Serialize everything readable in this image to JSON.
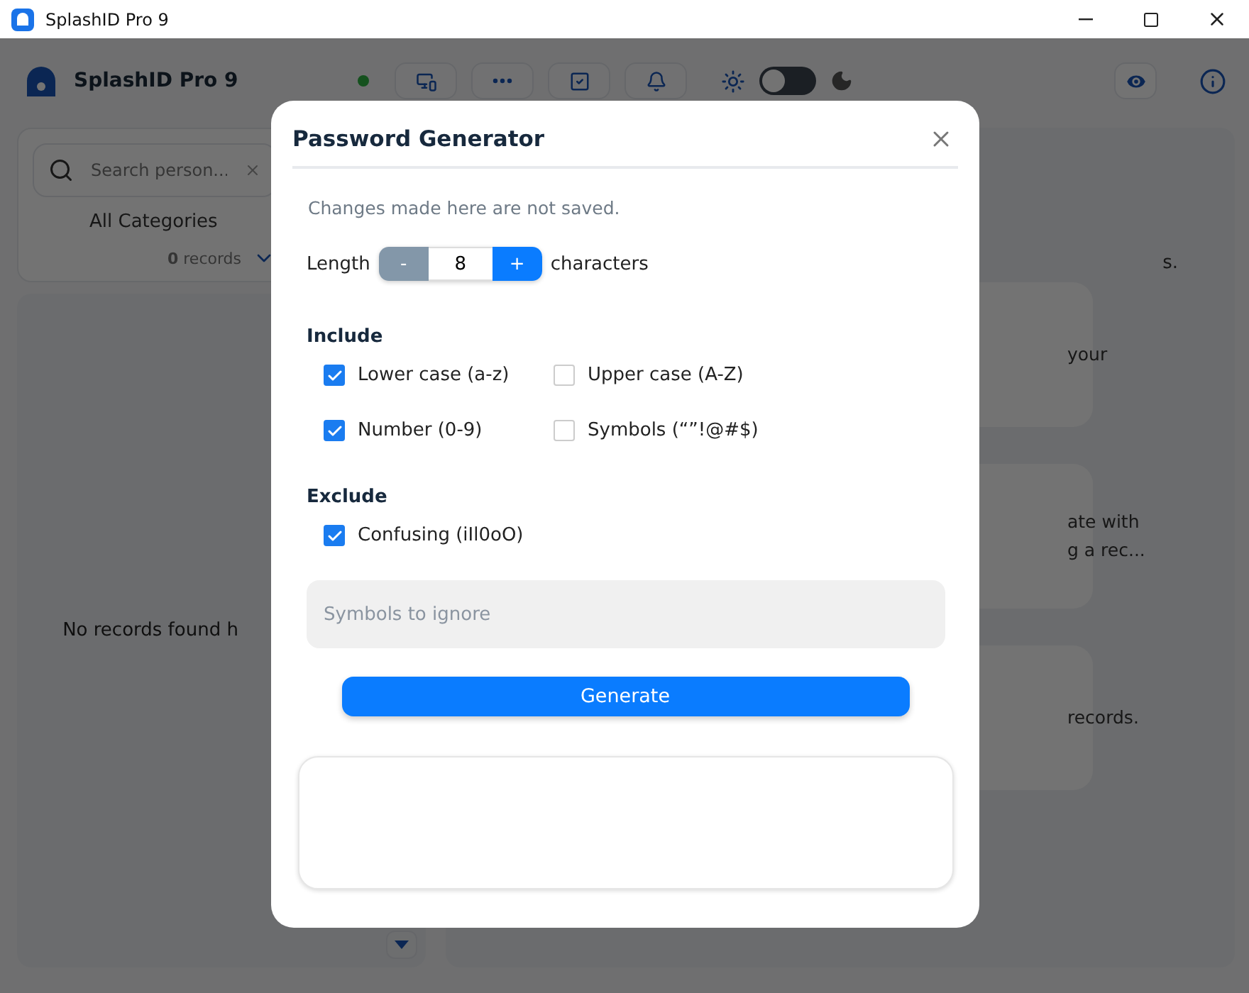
{
  "window": {
    "title": "SplashID Pro 9"
  },
  "header": {
    "app_name": "SplashID Pro 9",
    "status_online": true,
    "toolbar": [
      {
        "kind": "devices"
      },
      {
        "kind": "password"
      },
      {
        "kind": "tasks"
      },
      {
        "kind": "alerts"
      }
    ],
    "dark_mode": {
      "on": false
    }
  },
  "sidebar": {
    "search": {
      "placeholder": "Search person..."
    },
    "category": "All Categories",
    "records_count": "0",
    "records_label": "records",
    "empty_message": "No records found h"
  },
  "main": {
    "intro": "s.",
    "cards": [
      {
        "text": "your"
      },
      {
        "text": "ate with\ng a rec..."
      },
      {
        "text": "records."
      }
    ]
  },
  "dialog": {
    "title": "Password Generator",
    "note": "Changes made here are not saved.",
    "length_label": "Length",
    "decrement": "-",
    "length": "8",
    "increment": "+",
    "length_unit": "characters",
    "include_heading": "Include",
    "include": [
      {
        "label": "Lower case (a-z)",
        "checked": true
      },
      {
        "label": "Upper case (A-Z)",
        "checked": false
      },
      {
        "label": "Number (0-9)",
        "checked": true
      },
      {
        "label": "Symbols (“”!@#$)",
        "checked": false
      }
    ],
    "exclude_heading": "Exclude",
    "exclude": [
      {
        "label": "Confusing (iIl0oO)",
        "checked": true
      }
    ],
    "ignore_field": {
      "placeholder": "Symbols to ignore"
    },
    "generate_button": "Generate"
  }
}
